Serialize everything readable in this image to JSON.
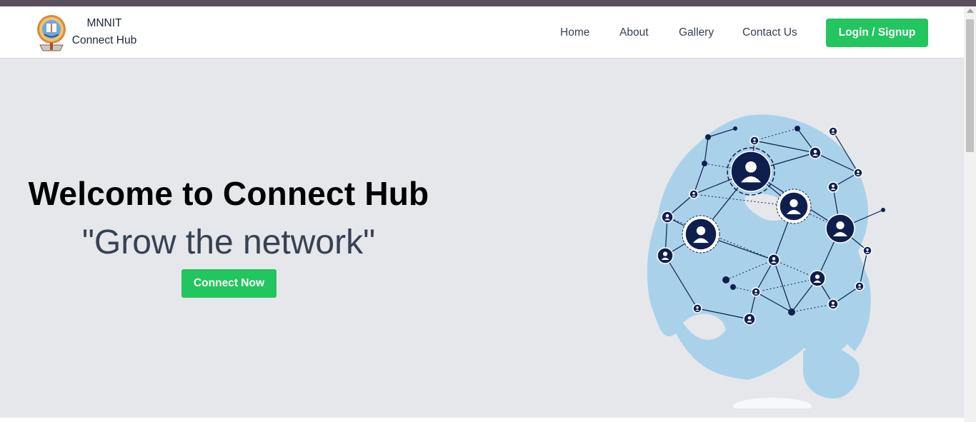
{
  "brand": {
    "line1": "MNNIT",
    "line2": "Connect Hub"
  },
  "nav": {
    "home": "Home",
    "about": "About",
    "gallery": "Gallery",
    "contact": "Contact Us",
    "login": "Login / Signup"
  },
  "hero": {
    "title": "Welcome to Connect Hub",
    "subtitle": "\"Grow the network\"",
    "cta": "Connect Now"
  },
  "colors": {
    "accent": "#22c55e",
    "hero_bg": "#e5e7eb",
    "network_navy": "#0f1f4d",
    "globe_blue": "#a9d2ea"
  },
  "icons": [
    "college-logo-icon",
    "globe-network-icon",
    "user-node-icon"
  ]
}
